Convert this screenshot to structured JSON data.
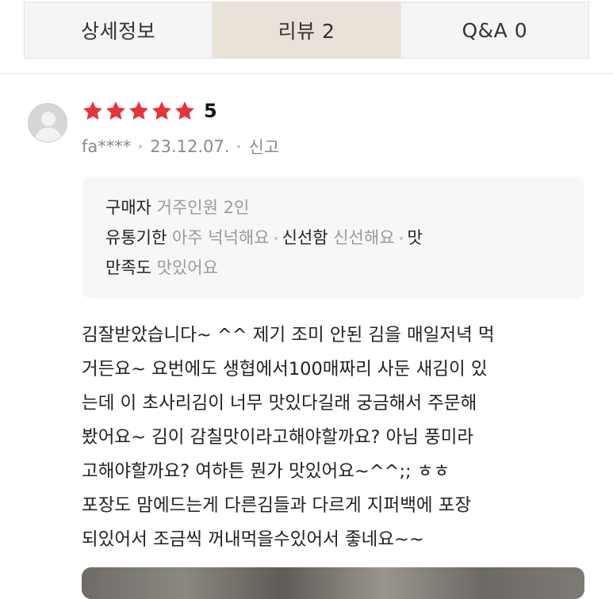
{
  "tabs": [
    {
      "label": "상세정보",
      "active": false
    },
    {
      "label": "리뷰  2",
      "active": true
    },
    {
      "label": "Q&A  0",
      "active": false
    }
  ],
  "review": {
    "rating": "5",
    "star_count": 5,
    "star_color": "#e8323c",
    "user": "fa****",
    "date": "23.12.07.",
    "report_label": "신고",
    "options": {
      "line1": {
        "key": "구매자",
        "value": "거주인원 2인"
      },
      "line2": {
        "key1": "유통기한",
        "value1": "아주 넉넉해요",
        "key2": "신선함",
        "value2": "신선해요",
        "key3": "맛"
      },
      "line3": {
        "key": "만족도",
        "value": "맛있어요"
      }
    },
    "body_lines": [
      "김잘받았습니다~ ^^  제기 조미 안된 김을 매일저녁 먹",
      "거든요~  요번에도 생협에서100매짜리 사둔 새김이 있",
      "는데  이 초사리김이 너무 맛있다길래 궁금해서 주문해",
      "봤어요~    김이 감칠맛이라고해야할까요?  아님 풍미라",
      "고해야할까요?  여하튼 뭔가 맛있어요~^^;;   ㅎㅎ",
      " 포장도 맘에드는게 다른김들과 다르게  지퍼백에 포장",
      "되있어서 조금씩 꺼내먹을수있어서 좋네요~~"
    ]
  }
}
